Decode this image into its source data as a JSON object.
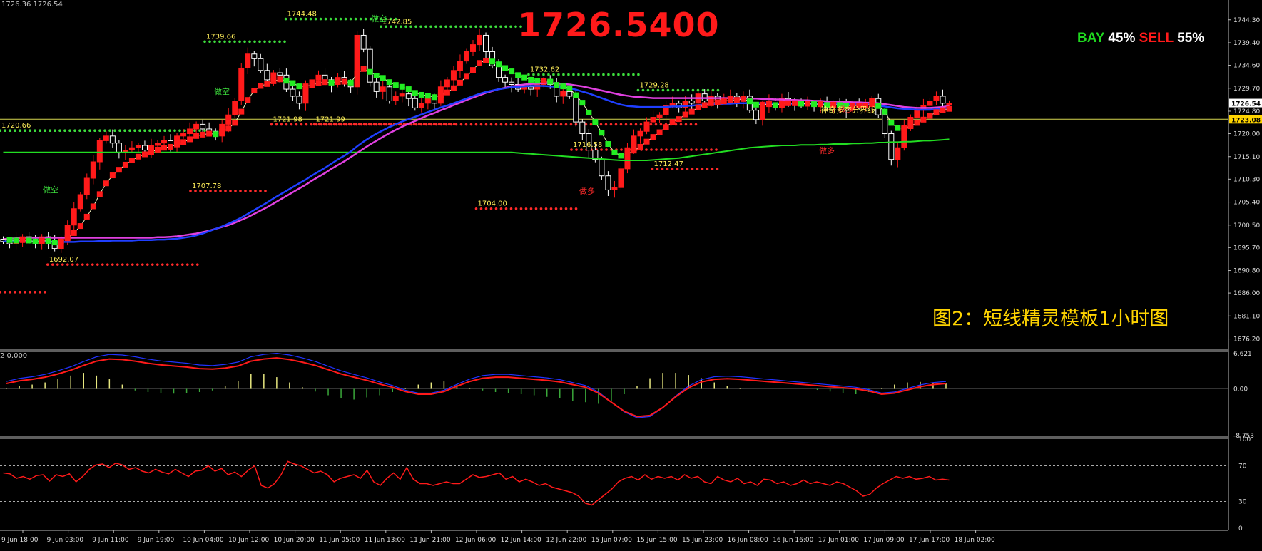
{
  "header": {
    "price_info": "1726.36 1726.54"
  },
  "big_price": "1726.5400",
  "ratio": {
    "bay_label": "BAY",
    "bay_value": "45%",
    "sell_label": "SELL",
    "sell_value": "55%"
  },
  "caption": "图2：短线精灵模板1小时图",
  "macd_label": "2 0.000",
  "colors": {
    "bull": "#ff1a1a",
    "bear": "#ffffff",
    "green_candle": "#22ee22",
    "ma_blue": "#1f3fff",
    "ma_magenta": "#e040e0",
    "ma_green": "#22dd22",
    "support_dot": "#ff2a2a",
    "resistance_dot": "#3cdc3c",
    "label_yellow": "#ffef5a"
  },
  "chart_data": [
    {
      "type": "line",
      "panel": "price",
      "ylim": [
        1674,
        1747
      ],
      "y_ticks": [
        "1744.30",
        "1739.40",
        "1734.60",
        "1729.70",
        "1724.80",
        "1720.00",
        "1715.10",
        "1710.30",
        "1705.40",
        "1700.50",
        "1695.70",
        "1690.80",
        "1686.00",
        "1681.10",
        "1676.20"
      ],
      "x_labels": [
        "9 Jun 18:00",
        "9 Jun 03:00",
        "9 Jun 11:00",
        "9 Jun 19:00",
        "10 Jun 04:00",
        "10 Jun 12:00",
        "10 Jun 20:00",
        "11 Jun 05:00",
        "11 Jun 13:00",
        "11 Jun 21:00",
        "12 Jun 06:00",
        "12 Jun 14:00",
        "12 Jun 22:00",
        "15 Jun 07:00",
        "15 Jun 15:00",
        "15 Jun 23:00",
        "16 Jun 08:00",
        "16 Jun 16:00",
        "17 Jun 01:00",
        "17 Jun 09:00",
        "17 Jun 17:00",
        "18 Jun 02:00"
      ],
      "close": [
        1697,
        1696.5,
        1697.5,
        1698,
        1697,
        1696.5,
        1698,
        1697,
        1695.5,
        1697.5,
        1700.5,
        1704,
        1707,
        1710.5,
        1714,
        1718.5,
        1719.5,
        1718,
        1716,
        1716.5,
        1717,
        1717.5,
        1716.5,
        1717.5,
        1718,
        1718.5,
        1717.5,
        1719.5,
        1720,
        1721,
        1722,
        1721,
        1720.5,
        1719.5,
        1722,
        1724,
        1727,
        1734,
        1737,
        1736,
        1733.5,
        1731.5,
        1733,
        1732.5,
        1729.5,
        1728,
        1726.5,
        1730,
        1731.5,
        1732.5,
        1731.5,
        1730.5,
        1732,
        1731,
        1730,
        1741,
        1738,
        1731,
        1729,
        1730,
        1727,
        1728,
        1728.5,
        1727.5,
        1725.5,
        1726.5,
        1727.5,
        1726.5,
        1730,
        1731.5,
        1733.5,
        1735.5,
        1737.5,
        1739,
        1741,
        1737.5,
        1734.5,
        1732,
        1731,
        1730.5,
        1729.5,
        1730,
        1729.5,
        1730.5,
        1731.5,
        1730.5,
        1728,
        1729,
        1728,
        1722.5,
        1720,
        1716.5,
        1714.5,
        1711,
        1708,
        1708.5,
        1712.5,
        1717,
        1719.5,
        1720.5,
        1722.5,
        1723.5,
        1724,
        1726,
        1726.5,
        1725.5,
        1727,
        1726.5,
        1728.5,
        1727,
        1728,
        1727,
        1727.5,
        1728,
        1727,
        1728,
        1725,
        1723,
        1726,
        1727,
        1725.5,
        1727.5,
        1727,
        1726.5,
        1726,
        1726.5,
        1726,
        1726.5,
        1725.5,
        1726.5,
        1726,
        1725,
        1726.5,
        1726,
        1726,
        1727.5,
        1724,
        1720,
        1714.5,
        1717,
        1721.5,
        1723.5,
        1725,
        1726,
        1727,
        1728,
        1726.5,
        1726.5
      ],
      "ma_fast": [
        1697.5,
        1697.3,
        1697.2,
        1697.3,
        1697.2,
        1697,
        1697.2,
        1697.1,
        1696.8,
        1697,
        1697.7,
        1698.8,
        1700.3,
        1702.3,
        1704.5,
        1707.1,
        1709.4,
        1711.1,
        1712.3,
        1713.4,
        1714.3,
        1715.1,
        1715.6,
        1716.1,
        1716.6,
        1717,
        1717.2,
        1717.7,
        1718.2,
        1718.8,
        1719.5,
        1719.8,
        1720,
        1719.9,
        1720.4,
        1721.1,
        1722.3,
        1724.7,
        1727.2,
        1729.2,
        1730.2,
        1730.6,
        1731.2,
        1731.6,
        1731.3,
        1730.8,
        1730.1,
        1730.1,
        1730.4,
        1730.8,
        1731,
        1730.9,
        1731.1,
        1731.1,
        1730.9,
        1732.8,
        1733.8,
        1733.2,
        1732.4,
        1731.9,
        1731,
        1730.4,
        1730,
        1729.5,
        1728.7,
        1728.3,
        1728.1,
        1727.8,
        1728.2,
        1728.8,
        1729.7,
        1730.9,
        1732.2,
        1733.6,
        1735.1,
        1735.6,
        1735.4,
        1734.8,
        1734,
        1733.3,
        1732.5,
        1732,
        1731.5,
        1731.3,
        1731.3,
        1731.1,
        1730.4,
        1730.1,
        1729.7,
        1728.2,
        1726.6,
        1724.5,
        1722.5,
        1720.2,
        1717.8,
        1716,
        1715.3,
        1715.6,
        1716.4,
        1717.2,
        1718.3,
        1719.3,
        1720.3,
        1721.4,
        1722.5,
        1723.1,
        1724.1,
        1724.7,
        1725.6,
        1726.1,
        1726.5,
        1726.7,
        1726.9,
        1727.2,
        1727.2,
        1727.4,
        1726.9,
        1726.2,
        1726.2,
        1726.3,
        1726.1,
        1726.4,
        1726.5,
        1726.5,
        1726.4,
        1726.4,
        1726.3,
        1726.3,
        1726.1,
        1726.2,
        1726.1,
        1725.9,
        1726,
        1726,
        1726,
        1726.3,
        1725.9,
        1724.7,
        1722.3,
        1721.2,
        1721.2,
        1721.6,
        1722.3,
        1723,
        1723.8,
        1724.6,
        1725,
        1725.3
      ],
      "ma_blue": [
        1697,
        1697,
        1697,
        1697,
        1697,
        1697,
        1697,
        1697,
        1696.9,
        1696.9,
        1696.9,
        1696.9,
        1697,
        1697,
        1697,
        1697.1,
        1697.1,
        1697.2,
        1697.2,
        1697.2,
        1697.2,
        1697.3,
        1697.3,
        1697.3,
        1697.4,
        1697.4,
        1697.5,
        1697.6,
        1697.8,
        1698,
        1698.3,
        1698.7,
        1699.2,
        1699.7,
        1700.2,
        1700.8,
        1701.4,
        1702.1,
        1702.9,
        1703.7,
        1704.5,
        1705.3,
        1706.2,
        1707,
        1707.8,
        1708.6,
        1709.4,
        1710.2,
        1711.1,
        1711.9,
        1712.7,
        1713.6,
        1714.5,
        1715.3,
        1716.2,
        1717.3,
        1718.3,
        1719.2,
        1720,
        1720.7,
        1721.4,
        1722,
        1722.6,
        1723.1,
        1723.6,
        1724.1,
        1724.6,
        1725.1,
        1725.6,
        1726,
        1726.5,
        1727,
        1727.5,
        1728,
        1728.5,
        1728.9,
        1729.2,
        1729.5,
        1729.7,
        1729.9,
        1730,
        1730.1,
        1730.2,
        1730.2,
        1730.2,
        1730.1,
        1730,
        1729.9,
        1729.7,
        1729.4,
        1729,
        1728.6,
        1728.1,
        1727.6,
        1727.1,
        1726.6,
        1726.2,
        1725.9,
        1725.8,
        1725.7,
        1725.7,
        1725.7,
        1725.7,
        1725.7,
        1725.8,
        1725.8,
        1725.9,
        1726,
        1726.1,
        1726.2,
        1726.3,
        1726.3,
        1726.4,
        1726.4,
        1726.5,
        1726.5,
        1726.5,
        1726.5,
        1726.5,
        1726.5,
        1726.4,
        1726.4,
        1726.4,
        1726.4,
        1726.4,
        1726.4,
        1726.4,
        1726.4,
        1726.4,
        1726.4,
        1726.3,
        1726.3,
        1726.3,
        1726.3,
        1726.3,
        1726.2,
        1726,
        1725.8,
        1725.6,
        1725.4,
        1725.3,
        1725.2,
        1725.1,
        1725.1,
        1725.1,
        1725.2,
        1725.3,
        1725.4
      ],
      "ma_magenta": [
        1697.5,
        1697.6,
        1697.7,
        1697.8,
        1697.8,
        1697.8,
        1697.8,
        1697.8,
        1697.8,
        1697.8,
        1697.8,
        1697.8,
        1697.8,
        1697.8,
        1697.8,
        1697.8,
        1697.8,
        1697.8,
        1697.8,
        1697.8,
        1697.8,
        1697.8,
        1697.8,
        1697.8,
        1697.9,
        1697.9,
        1698,
        1698.1,
        1698.3,
        1698.5,
        1698.7,
        1699,
        1699.3,
        1699.7,
        1700.1,
        1700.5,
        1701,
        1701.6,
        1702.2,
        1702.9,
        1703.6,
        1704.3,
        1705.1,
        1705.9,
        1706.7,
        1707.5,
        1708.3,
        1709.1,
        1710,
        1710.8,
        1711.6,
        1712.5,
        1713.3,
        1714.1,
        1715,
        1715.9,
        1716.8,
        1717.7,
        1718.5,
        1719.3,
        1720.1,
        1720.8,
        1721.5,
        1722.1,
        1722.7,
        1723.3,
        1723.9,
        1724.4,
        1725,
        1725.5,
        1726.1,
        1726.6,
        1727.2,
        1727.7,
        1728.2,
        1728.7,
        1729.1,
        1729.5,
        1729.8,
        1730.1,
        1730.3,
        1730.5,
        1730.6,
        1730.7,
        1730.8,
        1730.8,
        1730.7,
        1730.6,
        1730.5,
        1730.3,
        1730.1,
        1729.8,
        1729.5,
        1729.2,
        1728.9,
        1728.6,
        1728.3,
        1728.1,
        1727.9,
        1727.8,
        1727.7,
        1727.6,
        1727.6,
        1727.6,
        1727.6,
        1727.6,
        1727.6,
        1727.6,
        1727.6,
        1727.6,
        1727.6,
        1727.6,
        1727.6,
        1727.6,
        1727.6,
        1727.6,
        1727.5,
        1727.5,
        1727.4,
        1727.4,
        1727.3,
        1727.3,
        1727.2,
        1727.2,
        1727.1,
        1727.1,
        1727,
        1727,
        1726.9,
        1726.9,
        1726.8,
        1726.8,
        1726.7,
        1726.7,
        1726.6,
        1726.6,
        1726.5,
        1726.3,
        1726.1,
        1725.9,
        1725.7,
        1725.6,
        1725.5,
        1725.5,
        1725.5,
        1725.6,
        1725.7,
        1725.9
      ],
      "ma_green_long": [
        1716,
        1716,
        1716,
        1716,
        1716,
        1716,
        1716,
        1716,
        1716,
        1716,
        1716,
        1716,
        1716,
        1716,
        1716,
        1716,
        1716,
        1716,
        1716,
        1716,
        1716,
        1716,
        1716,
        1716,
        1716,
        1716,
        1716,
        1716,
        1716,
        1716,
        1716,
        1716,
        1716,
        1716,
        1716,
        1716,
        1716,
        1716,
        1716,
        1716,
        1716,
        1716,
        1716,
        1716,
        1716,
        1716,
        1716,
        1716,
        1716,
        1716,
        1716,
        1716,
        1716,
        1716,
        1716,
        1716,
        1716,
        1716,
        1716,
        1716,
        1716,
        1716,
        1716,
        1716,
        1716,
        1716,
        1716,
        1716,
        1716,
        1716,
        1716,
        1716,
        1716,
        1716,
        1716,
        1716,
        1716,
        1716,
        1716,
        1716,
        1715.9,
        1715.8,
        1715.7,
        1715.6,
        1715.5,
        1715.4,
        1715.3,
        1715.2,
        1715.1,
        1715,
        1714.9,
        1714.8,
        1714.7,
        1714.6,
        1714.5,
        1714.4,
        1714.3,
        1714.3,
        1714.3,
        1714.3,
        1714.3,
        1714.4,
        1714.5,
        1714.6,
        1714.7,
        1714.8,
        1715,
        1715.2,
        1715.4,
        1715.6,
        1715.8,
        1716,
        1716.2,
        1716.4,
        1716.6,
        1716.8,
        1717,
        1717.1,
        1717.2,
        1717.3,
        1717.4,
        1717.5,
        1717.5,
        1717.5,
        1717.6,
        1717.6,
        1717.6,
        1717.7,
        1717.7,
        1717.8,
        1717.8,
        1717.8,
        1717.9,
        1717.9,
        1718,
        1718,
        1718.1,
        1718.1,
        1718.2,
        1718.2,
        1718.3,
        1718.3,
        1718.4,
        1718.5,
        1718.5,
        1718.6,
        1718.7,
        1718.8
      ],
      "levels": [
        {
          "value": "1744.48",
          "price": 1744.48,
          "kind": "resistance",
          "x0": 0.3,
          "x1": 0.42
        },
        {
          "value": "1742.85",
          "price": 1742.85,
          "kind": "resistance",
          "x0": 0.4,
          "x1": 0.55
        },
        {
          "value": "1739.66",
          "price": 1739.66,
          "kind": "resistance",
          "x0": 0.215,
          "x1": 0.3
        },
        {
          "value": "1732.62",
          "price": 1732.62,
          "kind": "resistance",
          "x0": 0.555,
          "x1": 0.675
        },
        {
          "value": "1729.28",
          "price": 1729.28,
          "kind": "resistance",
          "x0": 0.67,
          "x1": 0.755
        },
        {
          "value": "1720.66",
          "price": 1720.66,
          "kind": "resistance",
          "x0": 0.0,
          "x1": 0.215
        },
        {
          "value": "1721.98",
          "price": 1721.98,
          "kind": "support",
          "x0": 0.285,
          "x1": 0.735
        },
        {
          "value": "1721.99",
          "price": 1721.99,
          "kind": "support",
          "x0": 0.33,
          "x1": 0.48
        },
        {
          "value": "1716.58",
          "price": 1716.58,
          "kind": "support",
          "x0": 0.6,
          "x1": 0.755
        },
        {
          "value": "1712.47",
          "price": 1712.47,
          "kind": "support",
          "x0": 0.685,
          "x1": 0.755
        },
        {
          "value": "1707.78",
          "price": 1707.78,
          "kind": "support",
          "x0": 0.2,
          "x1": 0.28
        },
        {
          "value": "1704.00",
          "price": 1704.0,
          "kind": "support",
          "x0": 0.5,
          "x1": 0.605
        },
        {
          "value": "1692.07",
          "price": 1692.07,
          "kind": "support",
          "x0": 0.05,
          "x1": 0.21
        },
        {
          "value": "",
          "price": 1686.2,
          "kind": "support",
          "x0": 0.0,
          "x1": 0.05
        }
      ],
      "annotations": [
        "做空",
        "做多",
        "神奇多空分界线"
      ],
      "price_badges": [
        "1726.54",
        "1723.08"
      ],
      "boundary_line": 1723.08,
      "current_line": 1726.54
    },
    {
      "type": "bar",
      "panel": "macd",
      "y_ticks": [
        "6.621",
        "0.00",
        "-8.753"
      ],
      "ylim": [
        -8.753,
        6.621
      ],
      "signal": [
        1,
        1.5,
        1.8,
        2.2,
        2.8,
        3.5,
        4.4,
        5.2,
        5.6,
        5.5,
        5.2,
        4.8,
        4.5,
        4.3,
        4.1,
        3.8,
        3.7,
        3.9,
        4.3,
        5.2,
        5.6,
        5.8,
        5.5,
        5.0,
        4.4,
        3.6,
        2.8,
        2.2,
        1.6,
        0.9,
        0.3,
        -0.5,
        -1.0,
        -1.0,
        -0.5,
        0.5,
        1.4,
        2.0,
        2.2,
        2.2,
        2.0,
        1.8,
        1.6,
        1.3,
        0.8,
        0.3,
        -0.8,
        -2.5,
        -4.2,
        -5.2,
        -5.0,
        -3.5,
        -1.5,
        0.2,
        1.3,
        1.8,
        1.9,
        1.8,
        1.6,
        1.4,
        1.2,
        1.0,
        0.8,
        0.6,
        0.4,
        0.2,
        0.0,
        -0.4,
        -1.0,
        -0.8,
        -0.2,
        0.4,
        0.8,
        1.0
      ],
      "hist": [
        0.2,
        0.5,
        0.8,
        1.2,
        1.8,
        2.5,
        3.0,
        2.5,
        1.8,
        0.8,
        -0.3,
        -0.6,
        -0.8,
        -0.9,
        -0.8,
        -0.6,
        -0.3,
        0.5,
        1.5,
        2.8,
        2.8,
        2.2,
        1.2,
        0.3,
        -0.5,
        -1.2,
        -1.8,
        -2.0,
        -1.6,
        -1.2,
        -0.6,
        0.2,
        0.8,
        1.2,
        1.4,
        0.8,
        0.2,
        -0.3,
        -0.6,
        -0.8,
        -1.0,
        -1.2,
        -1.5,
        -1.8,
        -2.2,
        -2.5,
        -2.8,
        -2.2,
        -1.0,
        0.5,
        2.0,
        3.0,
        3.0,
        2.6,
        2.0,
        1.2,
        0.6,
        0.2,
        0,
        0,
        0,
        0,
        0,
        -0.2,
        -0.5,
        -0.8,
        -1.0,
        -0.6,
        0.2,
        0.8,
        1.2,
        1.3,
        1.2,
        1.0
      ]
    },
    {
      "type": "line",
      "panel": "rsi",
      "y_ticks": [
        "100",
        "70",
        "30",
        "0"
      ],
      "ylim": [
        0,
        100
      ],
      "values": [
        62,
        61,
        56,
        58,
        55,
        59,
        60,
        53,
        60,
        58,
        61,
        52,
        58,
        66,
        71,
        72,
        68,
        73,
        71,
        66,
        68,
        64,
        62,
        66,
        63,
        61,
        66,
        62,
        58,
        64,
        65,
        70,
        64,
        67,
        60,
        63,
        58,
        65,
        70,
        48,
        45,
        50,
        60,
        75,
        72,
        70,
        66,
        62,
        64,
        60,
        52,
        56,
        58,
        60,
        56,
        65,
        52,
        48,
        56,
        62,
        55,
        68,
        55,
        50,
        50,
        48,
        50,
        52,
        50,
        50,
        55,
        60,
        57,
        58,
        60,
        62,
        55,
        58,
        52,
        55,
        52,
        48,
        50,
        46,
        44,
        42,
        40,
        36,
        28,
        26,
        32,
        38,
        44,
        52,
        56,
        58,
        54,
        60,
        55,
        58,
        56,
        58,
        54,
        60,
        56,
        58,
        52,
        50,
        58,
        54,
        52,
        56,
        50,
        52,
        48,
        55,
        54,
        50,
        52,
        48,
        50,
        54,
        50,
        52,
        50,
        48,
        52,
        50,
        46,
        42,
        36,
        38,
        45,
        50,
        54,
        58,
        56,
        58,
        55,
        56,
        58,
        54,
        55,
        54
      ]
    }
  ]
}
